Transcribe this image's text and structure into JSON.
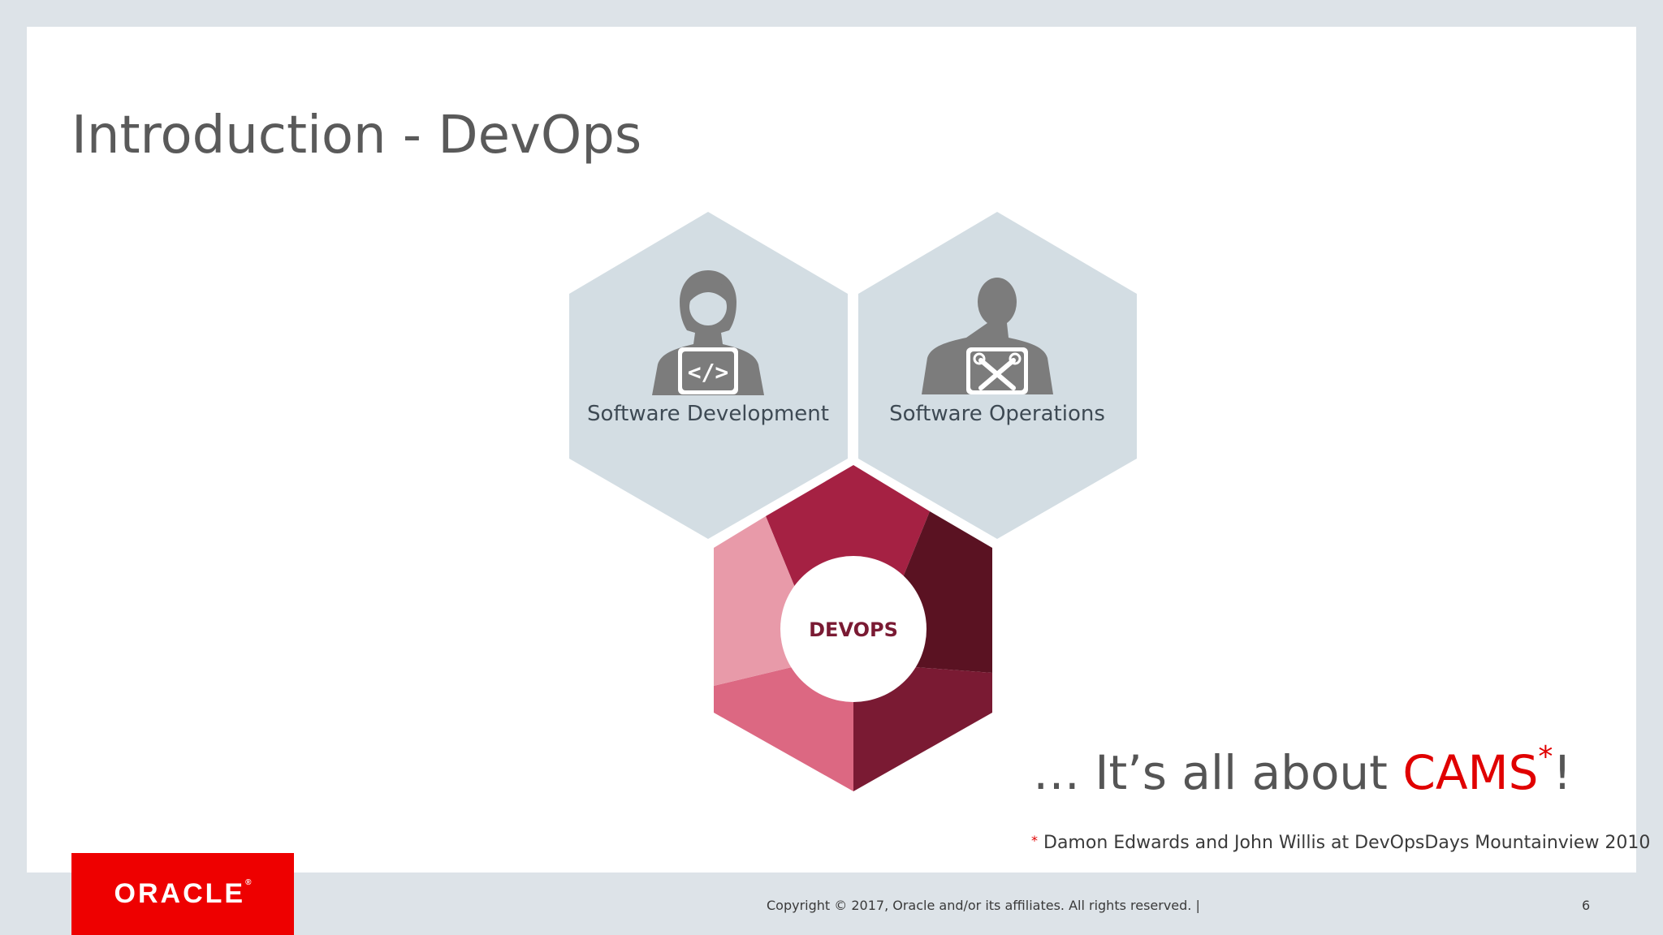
{
  "slide": {
    "title": "Introduction - DevOps",
    "page_number": "6"
  },
  "diagram": {
    "dev_label": "Software Development",
    "ops_label": "Software Operations",
    "core_label": "DEVOPS",
    "dev_icon": "developer-person-code-icon",
    "ops_icon": "operator-person-tools-icon",
    "code_glyph": "</>"
  },
  "tagline": {
    "prefix": "… It’s all about ",
    "highlight": "CAMS",
    "mark": "*",
    "suffix": "!"
  },
  "footnote": {
    "mark": "*",
    "text": "Damon Edwards and John Willis at DevOpsDays Mountainview 2010"
  },
  "footer": {
    "logo": "ORACLE",
    "logo_mark": "®",
    "copyright": "Copyright © 2017, Oracle and/or its affiliates. All rights reserved.  |"
  },
  "colors": {
    "hex_gray": "#d3dde3",
    "icon_gray": "#7c7c7c",
    "seg_1": "#a52143",
    "seg_2": "#5a1222",
    "seg_3": "#7a1a33",
    "seg_4": "#dc6882",
    "seg_5": "#e89aa9",
    "accent_red": "#e00000",
    "oracle_red": "#ee0000"
  }
}
